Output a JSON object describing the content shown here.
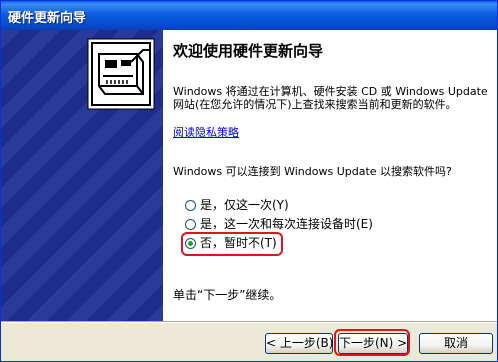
{
  "window": {
    "title": "硬件更新向导"
  },
  "sidebar": {
    "icon": "hardware-card-icon",
    "background_color": "#1f2f94"
  },
  "main": {
    "heading": "欢迎使用硬件更新向导",
    "intro": "Windows 将通过在计算机、硬件安装 CD 或 Windows Update 网站(在您允许的情况下)上查找来搜索当前和更新的软件。",
    "privacy_link": "阅读隐私策略",
    "question": "Windows 可以连接到 Windows Update 以搜索软件吗?",
    "options": [
      {
        "label": "是，仅这一次(Y)",
        "checked": false
      },
      {
        "label": "是，这一次和每次连接设备时(E)",
        "checked": false
      },
      {
        "label": "否，暂时不(T)",
        "checked": true
      }
    ],
    "continue_text": "单击“下一步”继续。"
  },
  "buttons": {
    "back": "< 上一步(B)",
    "next": "下一步(N) >",
    "cancel": "取消"
  },
  "highlight_color": "#e0141e"
}
